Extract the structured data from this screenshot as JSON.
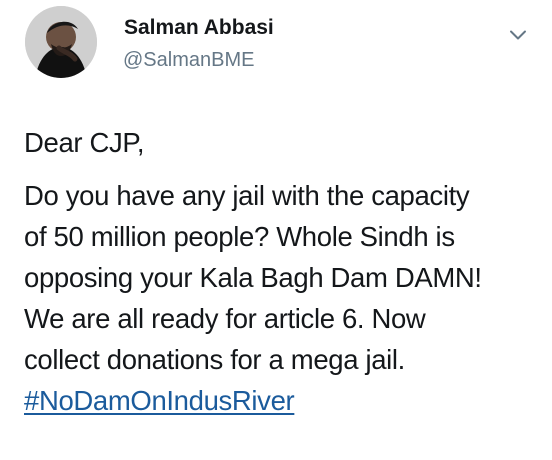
{
  "user": {
    "name": "Salman Abbasi",
    "handle": "@SalmanBME"
  },
  "tweet": {
    "greeting": "Dear CJP,",
    "lines": [
      "Do you have any jail with the capacity",
      "of 50 million people? Whole Sindh is",
      "opposing your Kala Bagh Dam DAMN!",
      "We are all ready for article 6. Now",
      "collect donations for a mega jail."
    ],
    "hashtag": "#NoDamOnIndusRiver"
  },
  "icons": {
    "avatar": "profile-photo",
    "menu": "chevron-down-icon"
  },
  "colors": {
    "text": "#14171a",
    "secondary_text": "#657786",
    "link": "#1b5b9c",
    "background": "#ffffff"
  }
}
